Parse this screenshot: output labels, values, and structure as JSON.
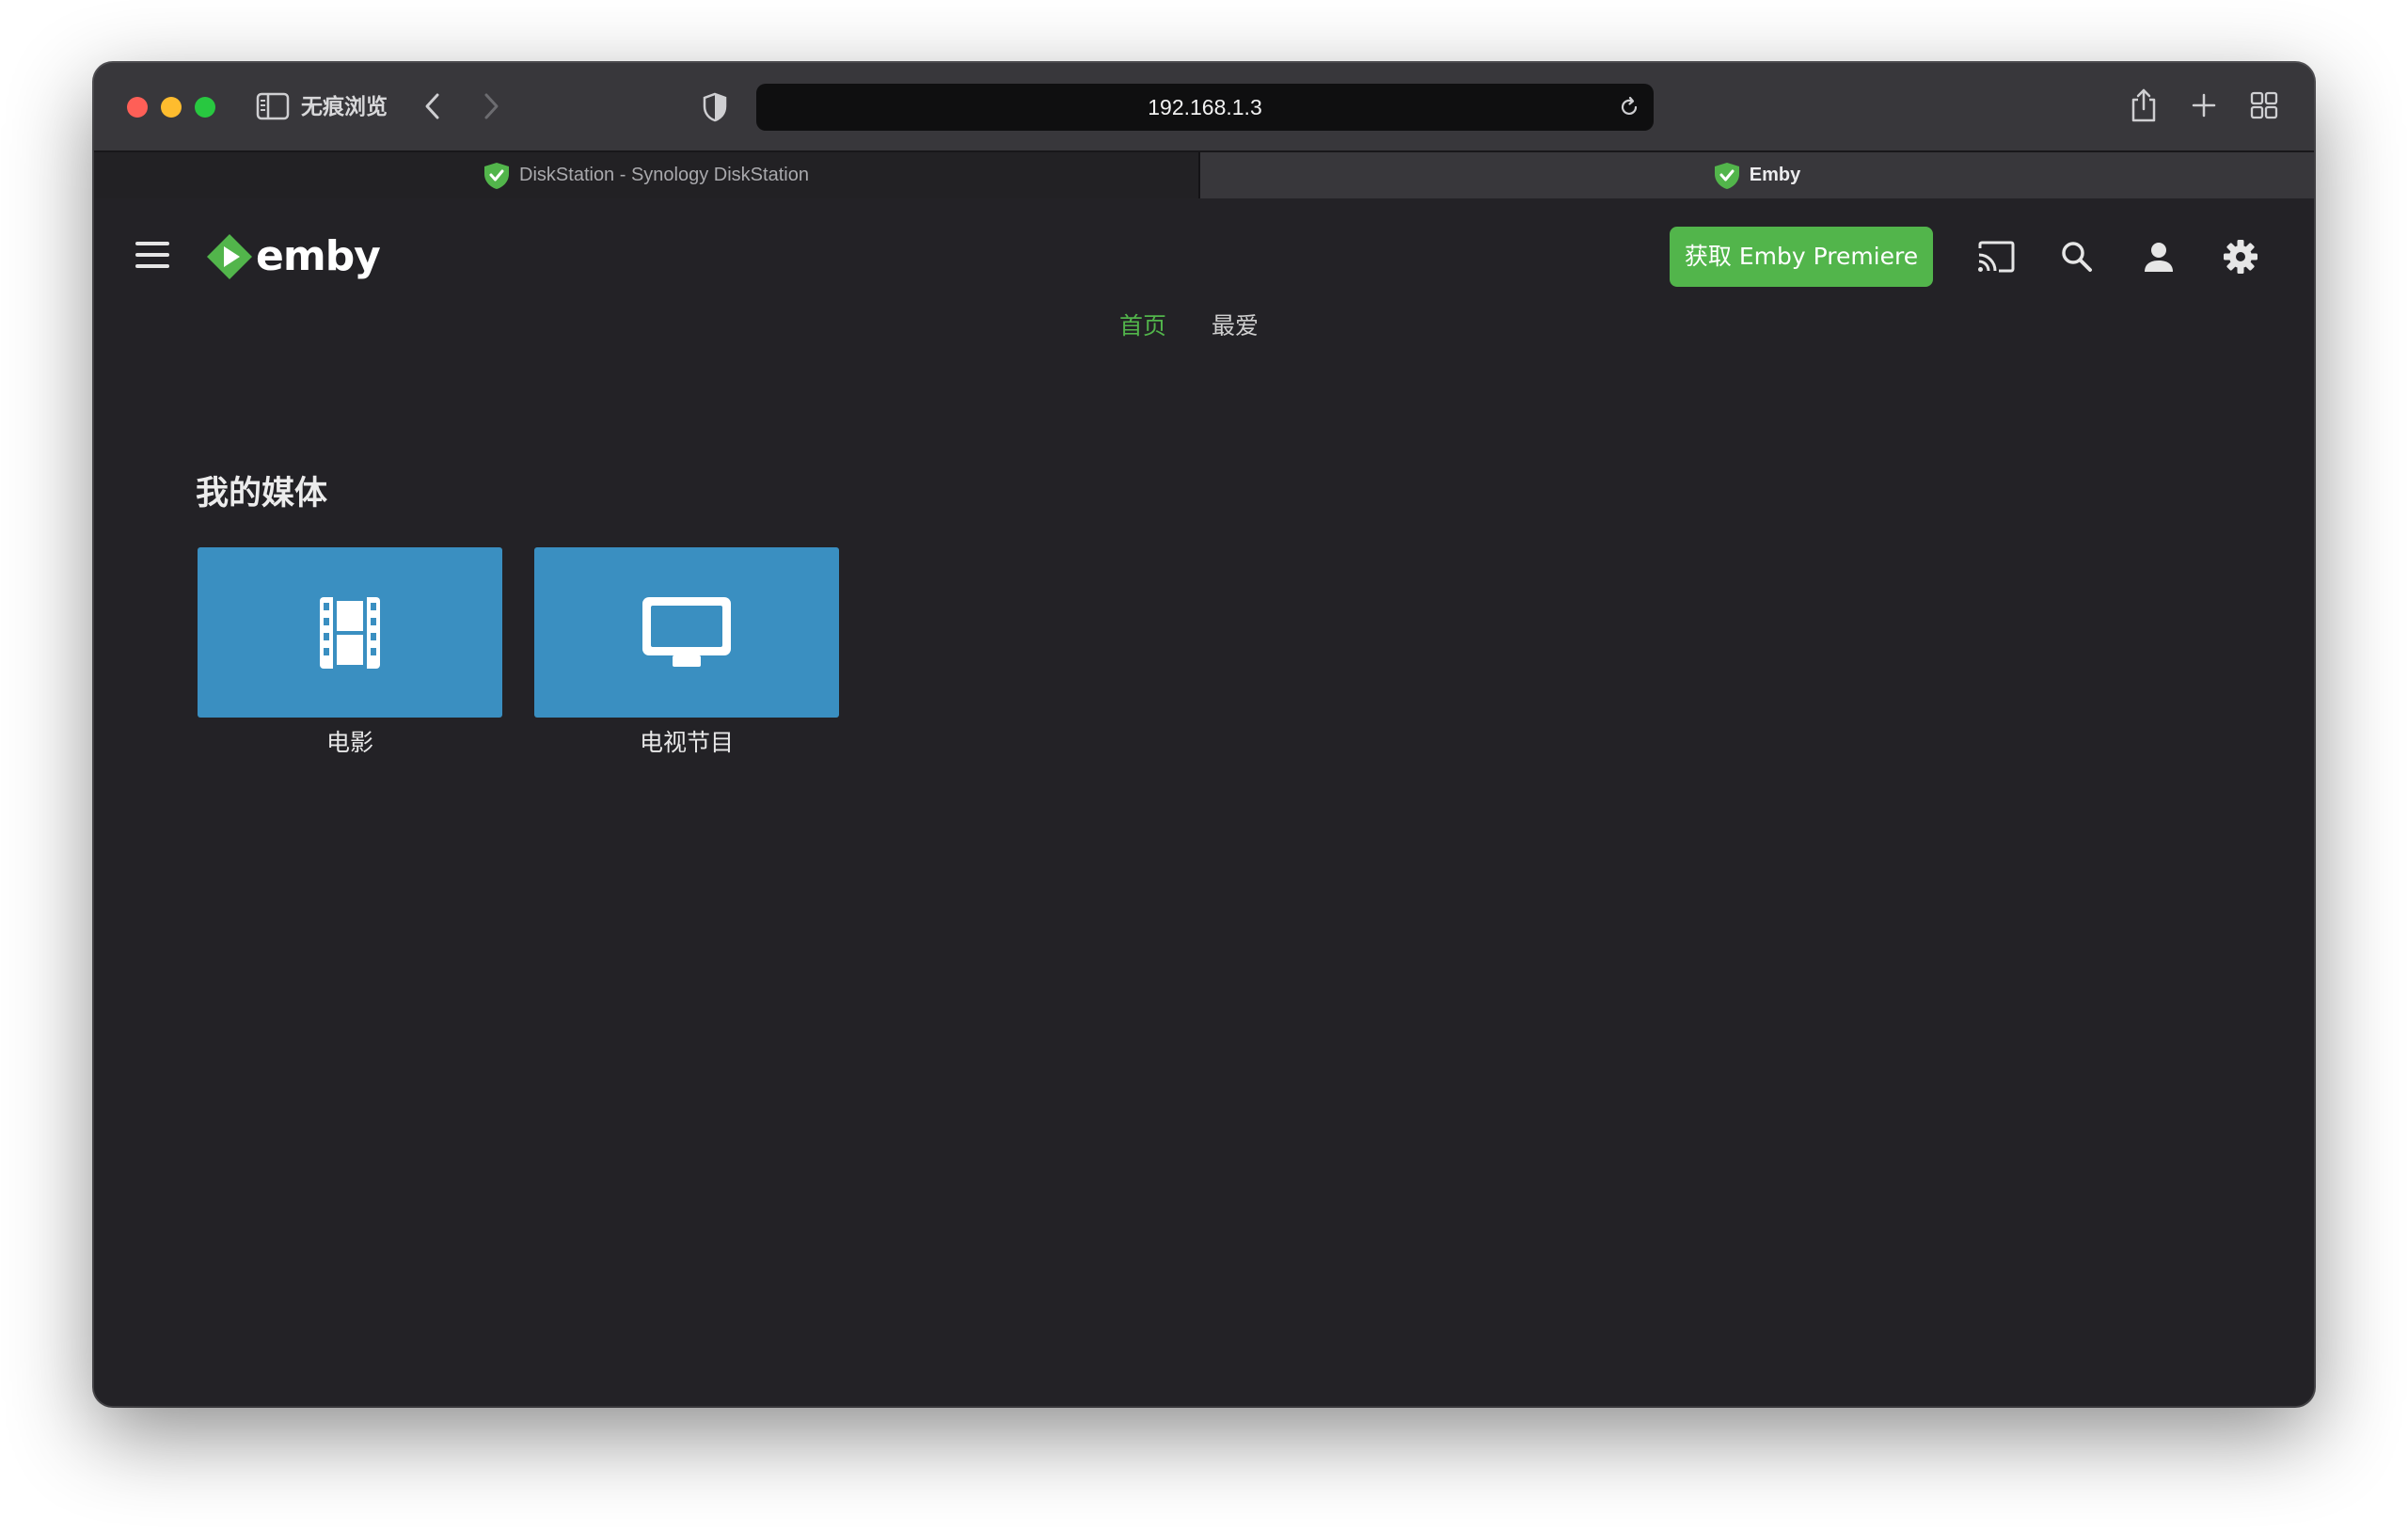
{
  "browser": {
    "private_label": "无痕浏览",
    "address": "192.168.1.3",
    "tabs": [
      {
        "title": "DiskStation - Synology DiskStation",
        "active": false
      },
      {
        "title": "Emby",
        "active": true
      }
    ]
  },
  "header": {
    "logo_text": "emby",
    "premiere_label": "获取 Emby Premiere",
    "icons": [
      "cast-icon",
      "search-icon",
      "user-icon",
      "settings-icon"
    ]
  },
  "nav": {
    "home_label": "首页",
    "favorites_label": "最爱"
  },
  "main": {
    "section_title": "我的媒体",
    "libraries": [
      {
        "label": "电影",
        "icon": "film-icon"
      },
      {
        "label": "电视节目",
        "icon": "tv-icon"
      }
    ]
  },
  "colors": {
    "accent": "#52b54b",
    "card_bg": "#3a8fc1",
    "app_bg": "#232226",
    "toolbar_bg": "#38373b"
  }
}
